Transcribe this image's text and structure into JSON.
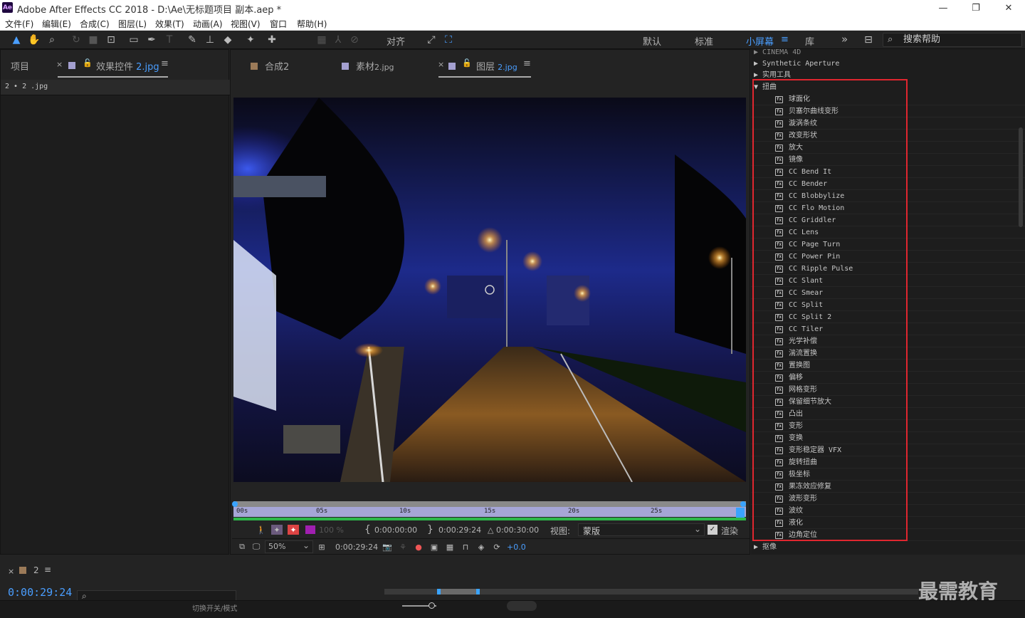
{
  "window": {
    "title": "Adobe After Effects CC 2018 - D:\\Ae\\无标题项目 副本.aep *",
    "app_icon_text": "Ae",
    "minimize": "—",
    "restore": "❐",
    "close": "✕"
  },
  "menu": [
    "文件(F)",
    "编辑(E)",
    "合成(C)",
    "图层(L)",
    "效果(T)",
    "动画(A)",
    "视图(V)",
    "窗口",
    "帮助(H)"
  ],
  "toolbar": {
    "align_label": "对齐",
    "workspaces": [
      "默认",
      "标准",
      "小屏幕",
      "库"
    ],
    "active_workspace": "小屏幕",
    "more": "»",
    "help_search_placeholder": "搜索帮助"
  },
  "project_panel": {
    "tab_project": "项目",
    "tab_effects_prefix": "效果控件",
    "tab_effects_file": "2.jpg",
    "breadcrumb": "2 • 2 .jpg"
  },
  "viewer_tabs": {
    "comp_label": "合成",
    "comp_name": "2",
    "footage_label": "素材",
    "footage_name": "2.jpg",
    "layer_label": "图层",
    "layer_name": "2.jpg",
    "comp_swatch": "#9b7a58",
    "footage_swatch": "#a4a0d0",
    "layer_swatch": "#a4a0d0"
  },
  "ruler": {
    "ticks": [
      "00s",
      "05s",
      "10s",
      "15s",
      "20s",
      "25s"
    ]
  },
  "viewer_controls": {
    "opacity": "100 %",
    "in_time": "0:00:00:00",
    "out_time": "0:00:29:24",
    "duration": "△ 0:00:30:00",
    "view_label": "视图:",
    "view_value": "蒙版",
    "render_label": "渲染",
    "zoom": "50%",
    "current_time": "0:00:29:24",
    "exposure": "+0.0"
  },
  "effects_panel": {
    "categories_above": [
      "CINEMA 4D",
      "Synthetic Aperture",
      "实用工具"
    ],
    "open_category": "扭曲",
    "items": [
      "球面化",
      "贝塞尔曲线变形",
      "漩涡条纹",
      "改变形状",
      "放大",
      "镜像",
      "CC Bend It",
      "CC Bender",
      "CC Blobbylize",
      "CC Flo Motion",
      "CC Griddler",
      "CC Lens",
      "CC Page Turn",
      "CC Power Pin",
      "CC Ripple Pulse",
      "CC Slant",
      "CC Smear",
      "CC Split",
      "CC Split 2",
      "CC Tiler",
      "光学补偿",
      "湍流置换",
      "置换图",
      "偏移",
      "网格变形",
      "保留细节放大",
      "凸出",
      "变形",
      "变换",
      "变形稳定器 VFX",
      "旋转扭曲",
      "极坐标",
      "果冻效应修复",
      "波形变形",
      "波纹",
      "液化",
      "边角定位"
    ],
    "next_category": "抠像",
    "highlight_color": "#e0262f"
  },
  "timeline": {
    "comp_tab": "2",
    "timecode": "0:00:29:24",
    "switch_label": "切换开关/模式"
  },
  "watermark": "最需教育"
}
